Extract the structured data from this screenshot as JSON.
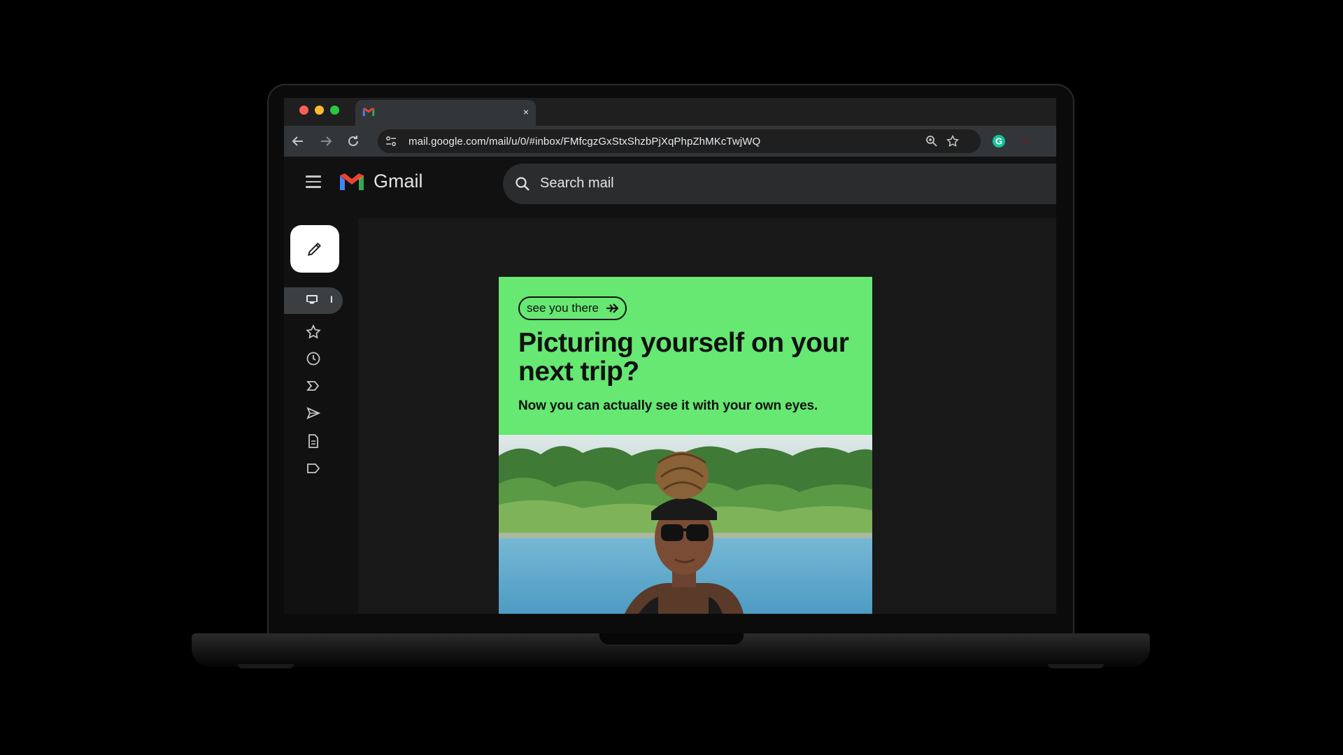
{
  "browser": {
    "tab_close": "×",
    "url": "mail.google.com/mail/u/0/#inbox/FMfcgzGxStxShzbPjXqPhpZhMKcTwjWQ",
    "extension_badge": "G"
  },
  "gmail": {
    "app_name": "Gmail",
    "search_placeholder": "Search mail",
    "inbox_count": "I",
    "nav_icons": [
      "inbox-icon",
      "star-icon",
      "clock-icon",
      "important-icon",
      "send-icon",
      "draft-icon",
      "label-icon"
    ]
  },
  "ad": {
    "pill_text": "see you there",
    "headline": "Picturing yourself on your next trip?",
    "subline": "Now you can actually see it with your own eyes."
  },
  "colors": {
    "ad_green": "#66e872",
    "gmail_red": "#ea4335",
    "gmail_blue": "#4285f4",
    "gmail_green": "#34a853",
    "gmail_yellow": "#fbbc04"
  }
}
